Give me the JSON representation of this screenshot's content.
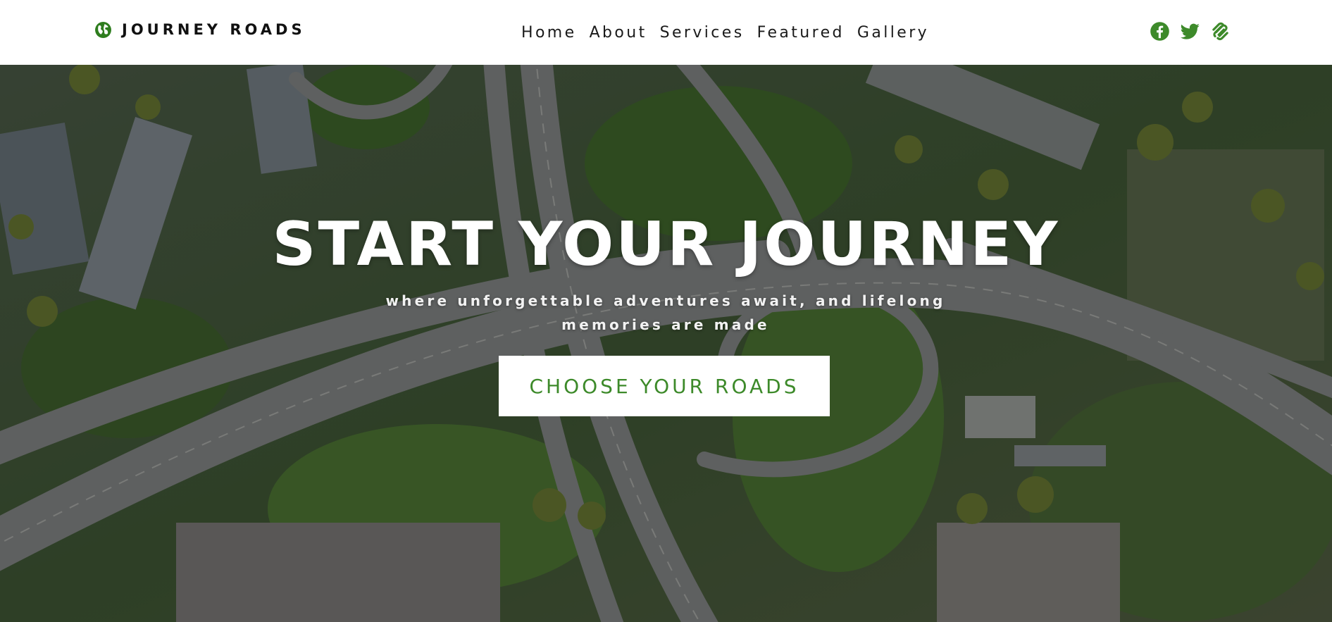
{
  "header": {
    "brand": {
      "name": "JOURNEY ROADS",
      "icon": "globe-icon"
    },
    "nav": [
      {
        "label": "Home"
      },
      {
        "label": "About"
      },
      {
        "label": "Services"
      },
      {
        "label": "Featured"
      },
      {
        "label": "Gallery"
      }
    ],
    "social": [
      {
        "icon": "facebook-icon"
      },
      {
        "icon": "twitter-icon"
      },
      {
        "icon": "squarespace-icon"
      }
    ]
  },
  "hero": {
    "background": "aerial-highway-interchange-image",
    "title": "START YOUR JOURNEY",
    "subtitle": "where unforgettable adventures await, and lifelong memories are made",
    "cta_label": "CHOOSE YOUR ROADS"
  },
  "colors": {
    "accent": "#3d8a2a",
    "header_bg": "#ffffff",
    "brand_text": "#111111",
    "hero_text": "#ffffff"
  }
}
